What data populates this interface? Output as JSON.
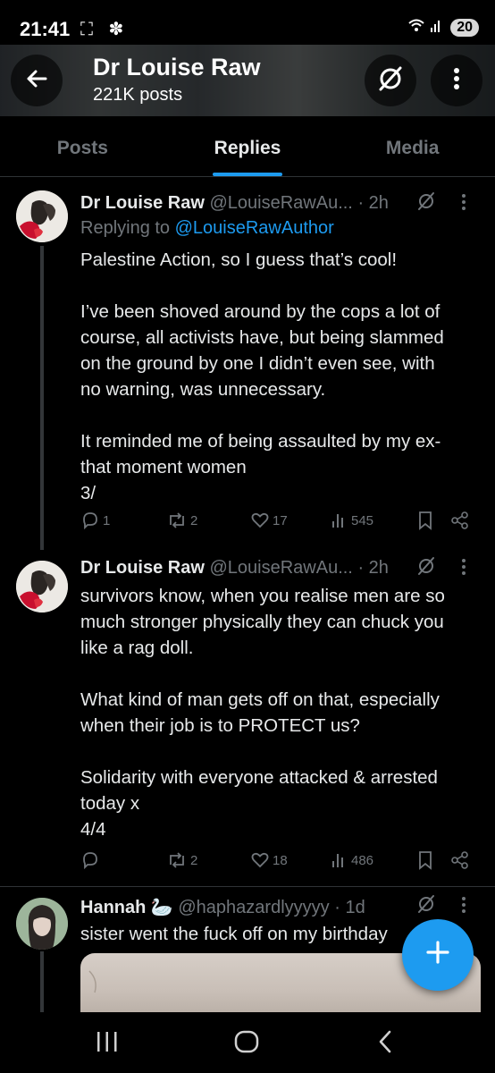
{
  "status_bar": {
    "time": "21:41",
    "left_icons": "⛶ ✽",
    "network": "⁵ .ıl",
    "battery": "20"
  },
  "header": {
    "name": "Dr Louise Raw",
    "post_count": "221K posts"
  },
  "tabs": [
    {
      "label": "Posts",
      "active": false
    },
    {
      "label": "Replies",
      "active": true
    },
    {
      "label": "Media",
      "active": false
    }
  ],
  "tweets": [
    {
      "name": "Dr Louise Raw",
      "handle": "@LouiseRawAu...",
      "sep": "·",
      "time": "2h",
      "replying_prefix": "Replying to",
      "replying_to": "@LouiseRawAuthor",
      "lines": [
        "Palestine Action, so I guess that’s cool!",
        "",
        "I’ve been shoved around by the cops a lot of",
        "course, all activists have, but being slammed",
        "on the ground by one I didn’t even see, with",
        "no warning, was unnecessary.",
        "",
        "It reminded me of being assaulted by my ex-",
        "that moment women",
        "3/"
      ],
      "replies": "1",
      "reposts": "2",
      "likes": "17",
      "views": "545"
    },
    {
      "name": "Dr Louise Raw",
      "handle": "@LouiseRawAu...",
      "sep": "·",
      "time": "2h",
      "lines": [
        "survivors know, when you realise men are so",
        "much stronger physically they can chuck you",
        "like a rag doll.",
        "",
        "What kind of man gets off on that, especially",
        "when their job is to PROTECT us?",
        "",
        "Solidarity with everyone attacked & arrested",
        "today x",
        "4/4"
      ],
      "replies": "",
      "reposts": "2",
      "likes": "18",
      "views": "486"
    },
    {
      "name": "Hannah 🦢",
      "handle": "@haphazardlyyyyy",
      "sep": "·",
      "time": "1d",
      "lines": [
        "sister went the fuck off on my birthday"
      ]
    }
  ],
  "icons": {
    "back": "arrow-left-icon",
    "grok": "grok-icon",
    "more": "more-vertical-icon",
    "fab": "plus-icon"
  },
  "colors": {
    "accent": "#1d9bf0",
    "muted": "#71767b",
    "background": "#000000"
  }
}
